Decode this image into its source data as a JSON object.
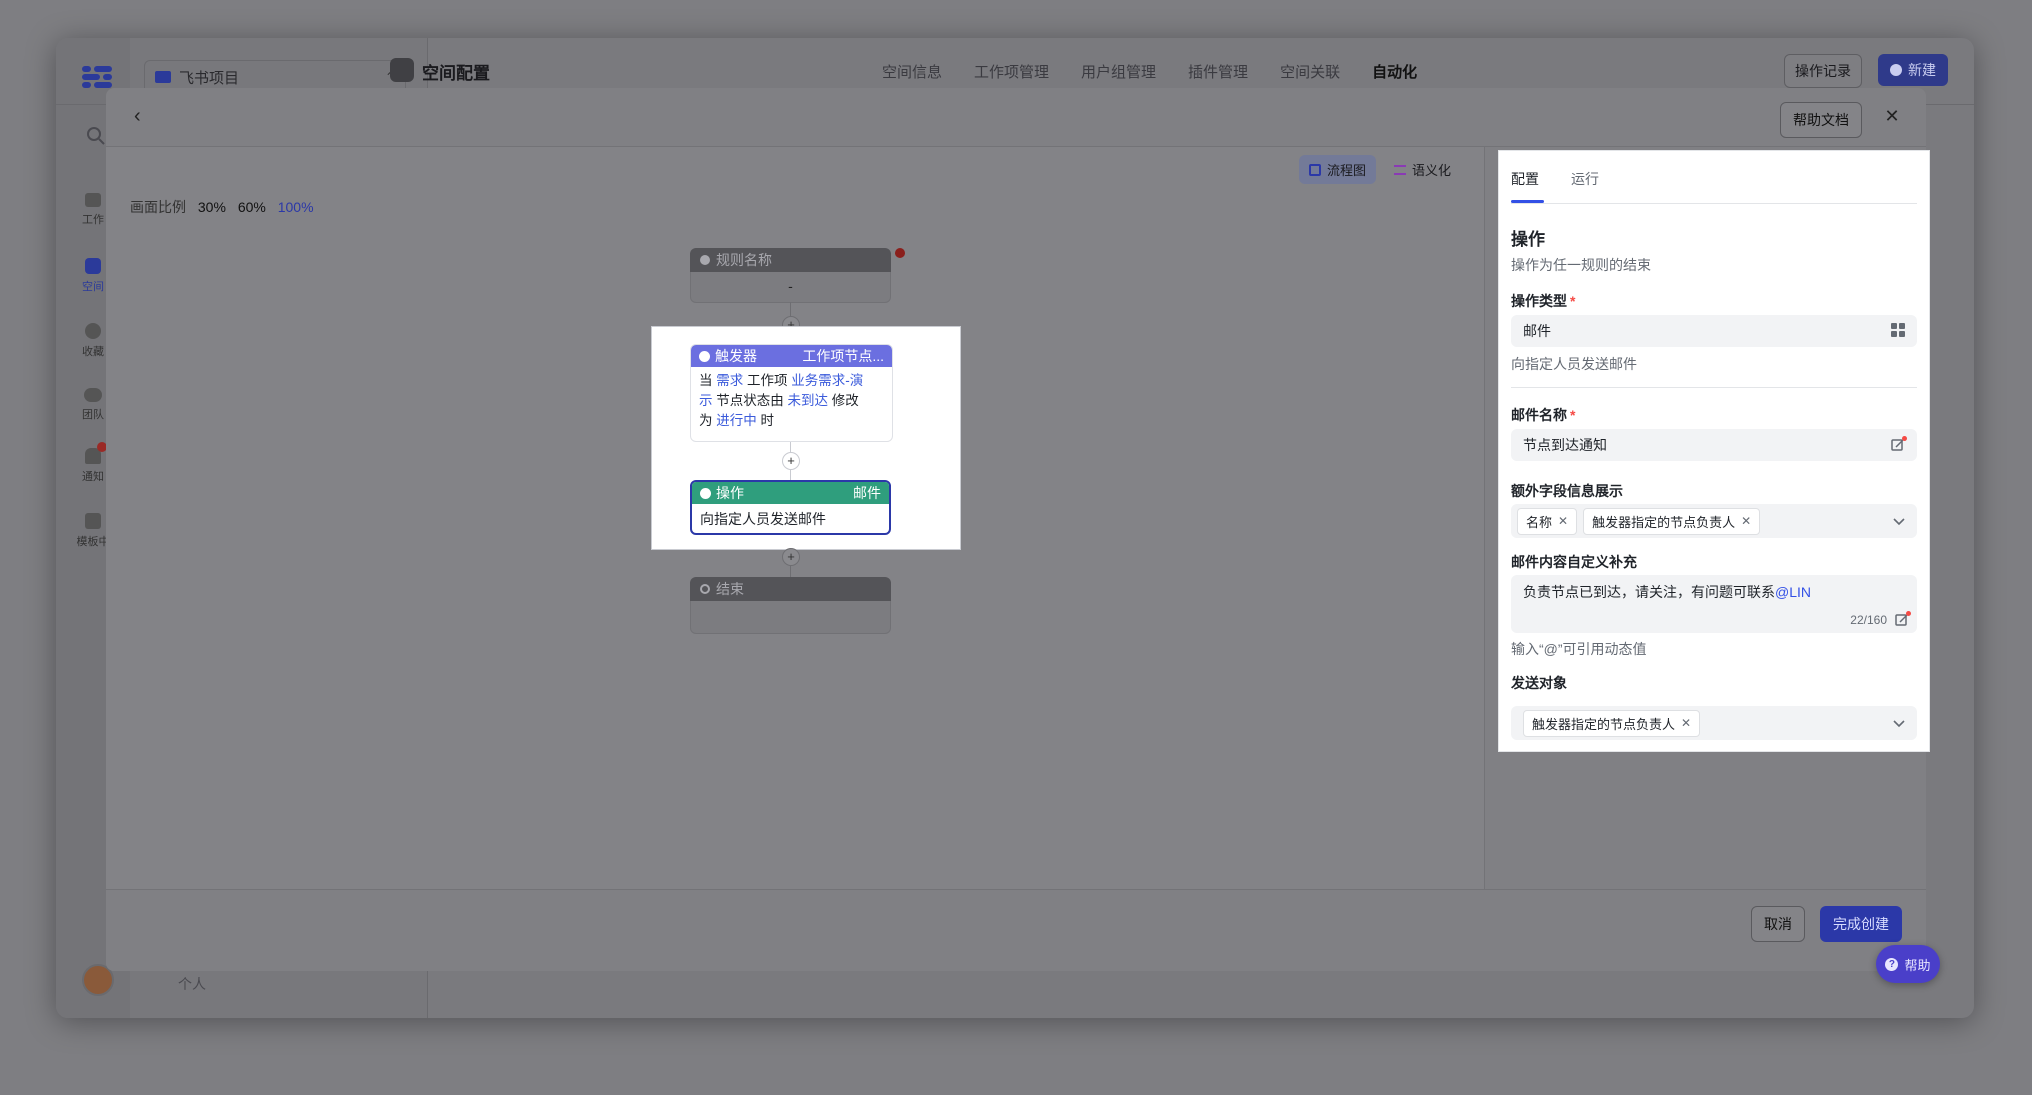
{
  "app": {
    "project_name": "飞书项目",
    "page_title": "空间配置",
    "nav_tabs": [
      "空间信息",
      "工作项管理",
      "用户组管理",
      "插件管理",
      "空间关联",
      "自动化"
    ],
    "active_tab": "自动化",
    "history_button": "操作记录",
    "new_button": "新建",
    "sidebar_items": [
      "工作",
      "空间",
      "收藏",
      "团队",
      "通知",
      "模板中"
    ],
    "sidebar_bottom": "个人"
  },
  "modal": {
    "help_doc_button": "帮助文档",
    "zoom_label": "画面比例",
    "zoom_options": [
      "30%",
      "60%",
      "100%"
    ],
    "active_zoom": "100%",
    "view_flowchart": "流程图",
    "view_semantic": "语义化",
    "cancel_button": "取消",
    "submit_button": "完成创建",
    "help_fab": "帮助"
  },
  "flow": {
    "rule_name_label": "规则名称",
    "rule_name_value": "-",
    "trigger": {
      "title": "触发器",
      "type": "工作项节点...",
      "text": {
        "p1": "当",
        "k1": "需求",
        "p2": "工作项",
        "k2": "业务需求-演",
        "k3": "示",
        "p3": "节点状态由",
        "k4": "未到达",
        "p4": "修改",
        "p5": "为",
        "k5": "进行中",
        "p6": "时"
      }
    },
    "action": {
      "title": "操作",
      "type": "邮件",
      "text": "向指定人员发送邮件"
    },
    "end_label": "结束"
  },
  "panel": {
    "tabs": [
      "配置",
      "运行"
    ],
    "active_tab": "配置",
    "section_title": "操作",
    "section_desc": "操作为任一规则的结束",
    "action_type_label": "操作类型",
    "action_type_value": "邮件",
    "action_type_hint": "向指定人员发送邮件",
    "mail_name_label": "邮件名称",
    "mail_name_value": "节点到达通知",
    "extra_fields_label": "额外字段信息展示",
    "extra_fields": [
      "名称",
      "触发器指定的节点负责人"
    ],
    "custom_content_label": "邮件内容自定义补充",
    "custom_content_text": "负责节点已到达，请关注，有问题可联系",
    "custom_content_mention": "@LIN",
    "custom_content_count": "22/160",
    "custom_content_hint": "输入“@”可引用动态值",
    "recipients_label": "发送对象",
    "recipients": [
      "触发器指定的节点负责人"
    ]
  },
  "colors": {
    "primary": "#3350e6",
    "trigger_head": "#6b6fe0",
    "action_head": "#2f9e7d",
    "required": "#f54a45"
  }
}
